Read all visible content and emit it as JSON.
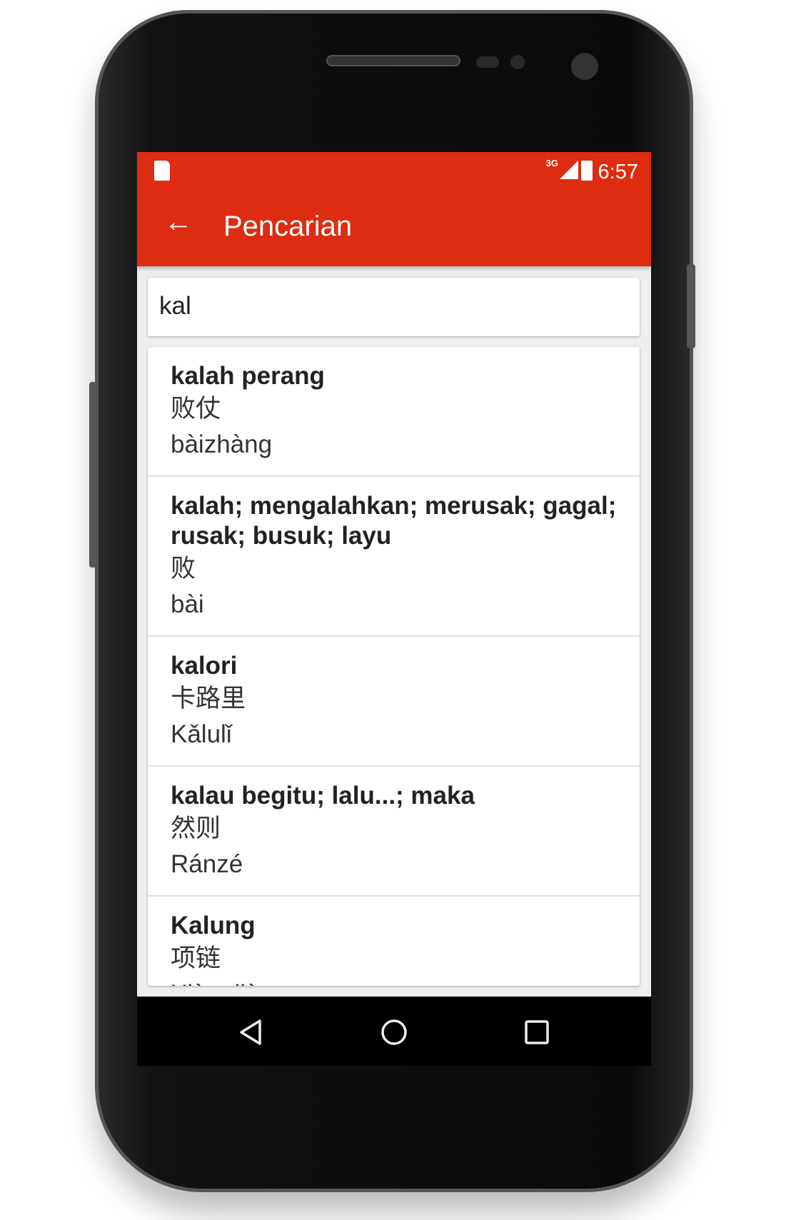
{
  "status": {
    "time": "6:57",
    "network": "3G",
    "icons": [
      "sd-card-icon",
      "signal-icon",
      "battery-charging-icon"
    ]
  },
  "appbar": {
    "title": "Pencarian",
    "back_icon": "arrow-left-icon"
  },
  "search": {
    "value": "kal"
  },
  "results": [
    {
      "word": "kalah perang",
      "chinese": "败仗",
      "pinyin": "bàizhàng"
    },
    {
      "word": "kalah; mengalahkan; merusak; gagal; rusak; busuk; layu",
      "chinese": "败",
      "pinyin": "bài"
    },
    {
      "word": "kalori",
      "chinese": "卡路里",
      "pinyin": "Kǎlulǐ"
    },
    {
      "word": "kalau begitu; lalu...; maka",
      "chinese": "然则",
      "pinyin": "Ránzé"
    },
    {
      "word": "Kalung",
      "chinese": "项链",
      "pinyin": "Xiàngliàn"
    }
  ],
  "colors": {
    "primary": "#dd2c12",
    "background": "#eeeeee"
  }
}
